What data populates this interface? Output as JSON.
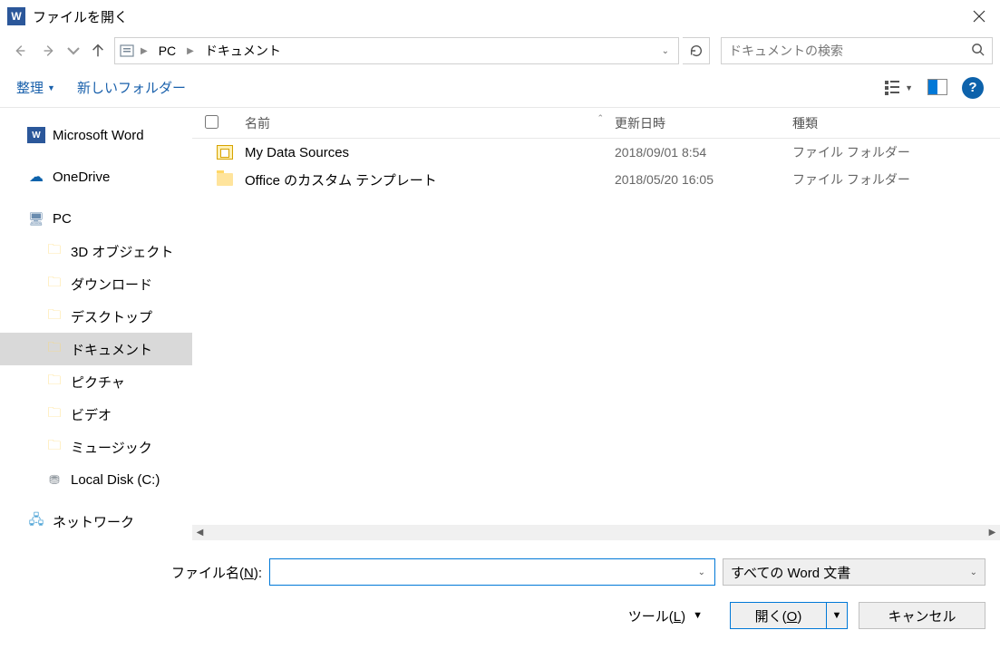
{
  "title": "ファイルを開く",
  "breadcrumb": {
    "root": "PC",
    "folder": "ドキュメント"
  },
  "search": {
    "placeholder": "ドキュメントの検索"
  },
  "toolbar": {
    "organize": "整理",
    "newfolder": "新しいフォルダー"
  },
  "tree": {
    "word": "Microsoft Word",
    "onedrive": "OneDrive",
    "pc": "PC",
    "items": [
      "3D オブジェクト",
      "ダウンロード",
      "デスクトップ",
      "ドキュメント",
      "ピクチャ",
      "ビデオ",
      "ミュージック",
      "Local Disk (C:)"
    ],
    "network": "ネットワーク"
  },
  "columns": {
    "name": "名前",
    "date": "更新日時",
    "type": "種類"
  },
  "files": [
    {
      "name": "My Data Sources",
      "date": "2018/09/01 8:54",
      "type": "ファイル フォルダー",
      "icon": "db"
    },
    {
      "name": "Office のカスタム テンプレート",
      "date": "2018/05/20 16:05",
      "type": "ファイル フォルダー",
      "icon": "folder"
    }
  ],
  "bottom": {
    "filename_label": "ファイル名(N):",
    "filter": "すべての Word 文書",
    "tools": "ツール(L)",
    "open": "開く(O)",
    "cancel": "キャンセル"
  }
}
